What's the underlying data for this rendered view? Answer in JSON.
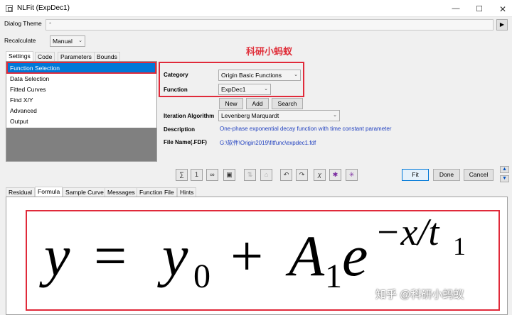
{
  "window": {
    "title": "NLFit (ExpDec1)",
    "minimize_icon": "minimize-icon",
    "maximize_icon": "maximize-icon",
    "close_icon": "close-icon"
  },
  "dialog_theme": {
    "label": "Dialog Theme",
    "value": "*"
  },
  "recalculate": {
    "label": "Recalculate",
    "value": "Manual"
  },
  "watermark_red": "科研小蚂蚁",
  "top_tabs": [
    "Settings",
    "Code",
    "Parameters",
    "Bounds"
  ],
  "settings_list": [
    "Function Selection",
    "Data Selection",
    "Fitted Curves",
    "Find X/Y",
    "Advanced",
    "Output"
  ],
  "category": {
    "label": "Category",
    "value": "Origin Basic Functions"
  },
  "function": {
    "label": "Function",
    "value": "ExpDec1"
  },
  "func_buttons": {
    "new": "New",
    "add": "Add",
    "search": "Search"
  },
  "iteration": {
    "label": "Iteration Algorithm",
    "value": "Levenberg Marquardt"
  },
  "description": {
    "label": "Description",
    "value": "One-phase exponential decay function with time constant parameter"
  },
  "file_name": {
    "label": "File Name(.FDF)",
    "value": "G:\\软件\\Origin2019\\fitfunc\\expdec1.fdf"
  },
  "actions": {
    "fit": "Fit",
    "done": "Done",
    "cancel": "Cancel"
  },
  "toolbar_icons": [
    "fit-all-icon",
    "fit-one-icon",
    "fit-until-converged-icon",
    "save-icon",
    "sort-icon",
    "tree-icon",
    "undo-icon",
    "redo-icon",
    "chi-square-icon",
    "parameter-fix-icon",
    "parameter-reset-icon"
  ],
  "bottom_tabs": [
    "Residual",
    "Formula",
    "Sample Curve",
    "Messages",
    "Function File",
    "Hints"
  ],
  "formula": {
    "y": "y",
    "eq": "=",
    "y0": "y",
    "y0sub": "0",
    "plus": "+",
    "A": "A",
    "Asub": "1",
    "e": "e",
    "exp": "−x/t",
    "expsub": "1"
  },
  "watermark": "知乎 @科研小蚂蚁"
}
